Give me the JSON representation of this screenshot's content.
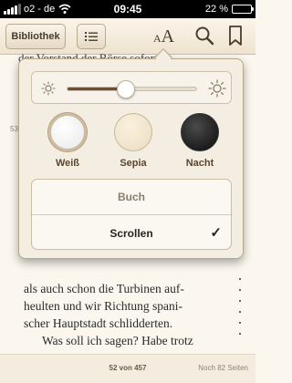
{
  "status_bar": {
    "carrier": "o2 - de",
    "time": "09:45",
    "battery": "22 %",
    "battery_fraction": 0.22
  },
  "toolbar": {
    "library_label": "Bibliothek",
    "toc_icon": "list-icon",
    "font_small": "A",
    "font_large": "A",
    "search_icon": "search-icon",
    "bookmark_icon": "bookmark-icon"
  },
  "page": {
    "top_text": "der Vorstand der Börse sofort",
    "left_page_number": "53",
    "body_lines": [
      "als auch schon die Turbinen auf-",
      "heulten und wir Richtung spani-",
      "scher Hauptstadt schlidderten.",
      "Was soll ich sagen? Habe trotz"
    ]
  },
  "settings": {
    "brightness": 0.45,
    "themes": [
      {
        "label": "Weiß",
        "selected": true
      },
      {
        "label": "Sepia",
        "selected": false
      },
      {
        "label": "Nacht",
        "selected": false
      }
    ],
    "modes": [
      {
        "label": "Buch",
        "selected": false
      },
      {
        "label": "Scrollen",
        "selected": true
      }
    ],
    "checkmark": "✓"
  },
  "footer": {
    "position": "52 von 457",
    "remaining": "Noch 82 Seiten"
  }
}
